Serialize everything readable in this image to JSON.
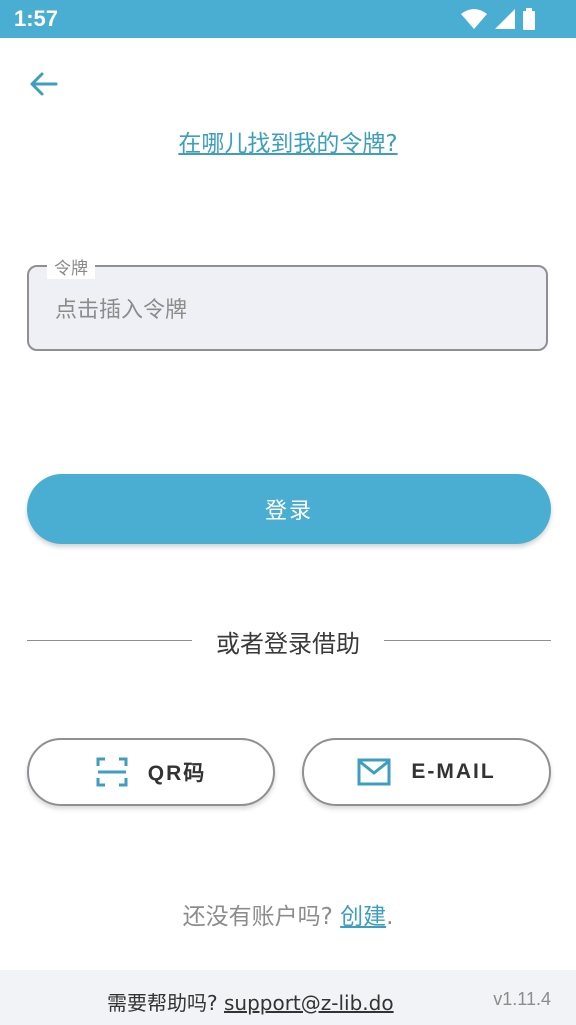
{
  "status_bar": {
    "time": "1:57",
    "icons": [
      "wifi-icon",
      "signal-icon",
      "battery-icon"
    ]
  },
  "header": {
    "back_icon": "arrow-left-icon",
    "where_link": "在哪儿找到我的令牌?"
  },
  "token_field": {
    "label": "令牌",
    "placeholder": "点击插入令牌",
    "value": ""
  },
  "login_button": {
    "label": "登录"
  },
  "divider_text": "或者登录借助",
  "alt_login": {
    "qr": {
      "icon": "qr-scan-icon",
      "label": "QR码"
    },
    "email": {
      "icon": "mail-icon",
      "label": "E-MAIL"
    }
  },
  "signup": {
    "prompt": "还没有账户吗?",
    "link": "创建",
    "suffix": "."
  },
  "footer": {
    "help_prompt": "需要帮助吗?",
    "email": "support@z-lib.do",
    "version": "v1.11.4"
  },
  "colors": {
    "accent": "#4aaed2",
    "link": "#3d9ebf",
    "footer_bg": "#f1f3f6"
  }
}
